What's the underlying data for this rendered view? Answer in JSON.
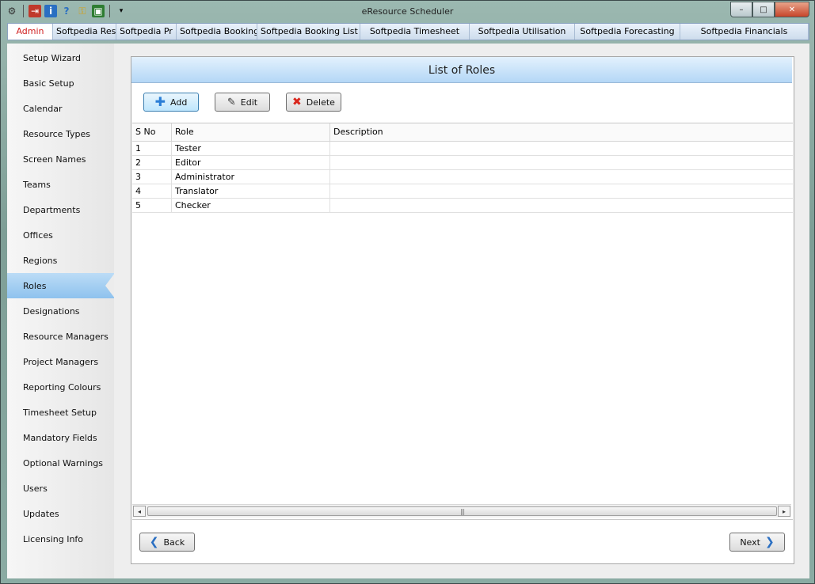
{
  "window": {
    "title": "eResource Scheduler",
    "minimize": "–",
    "maximize": "□",
    "close": "✕"
  },
  "quick_access": [
    "pin-icon",
    "exit-icon",
    "info-icon",
    "help-icon",
    "key-icon",
    "monitor-icon",
    "dropdown-icon"
  ],
  "tabs": [
    {
      "label": "Admin",
      "active": true
    },
    {
      "label": "Softpedia Reso"
    },
    {
      "label": "Softpedia Pr"
    },
    {
      "label": "Softpedia Booking"
    },
    {
      "label": "Softpedia Booking List"
    },
    {
      "label": "Softpedia Timesheet"
    },
    {
      "label": "Softpedia Utilisation"
    },
    {
      "label": "Softpedia Forecasting"
    },
    {
      "label": "Softpedia Financials"
    }
  ],
  "sidebar": {
    "active": "Roles",
    "items": [
      "Setup Wizard",
      "Basic Setup",
      "Calendar",
      "Resource Types",
      "Screen Names",
      "Teams",
      "Departments",
      "Offices",
      "Regions",
      "Roles",
      "Designations",
      "Resource Managers",
      "Project Managers",
      "Reporting Colours",
      "Timesheet Setup",
      "Mandatory Fields",
      "Optional Warnings",
      "Users",
      "Updates",
      "Licensing Info"
    ]
  },
  "panel": {
    "title": "List of Roles",
    "toolbar": {
      "add": "Add",
      "edit": "Edit",
      "delete": "Delete"
    },
    "table": {
      "columns": [
        "S No",
        "Role",
        "Description"
      ],
      "rows": [
        [
          "1",
          "Tester",
          ""
        ],
        [
          "2",
          "Editor",
          ""
        ],
        [
          "3",
          "Administrator",
          ""
        ],
        [
          "4",
          "Translator",
          ""
        ],
        [
          "5",
          "Checker",
          ""
        ]
      ]
    },
    "scroll_grip": "|||",
    "nav": {
      "back": "Back",
      "next": "Next"
    }
  }
}
